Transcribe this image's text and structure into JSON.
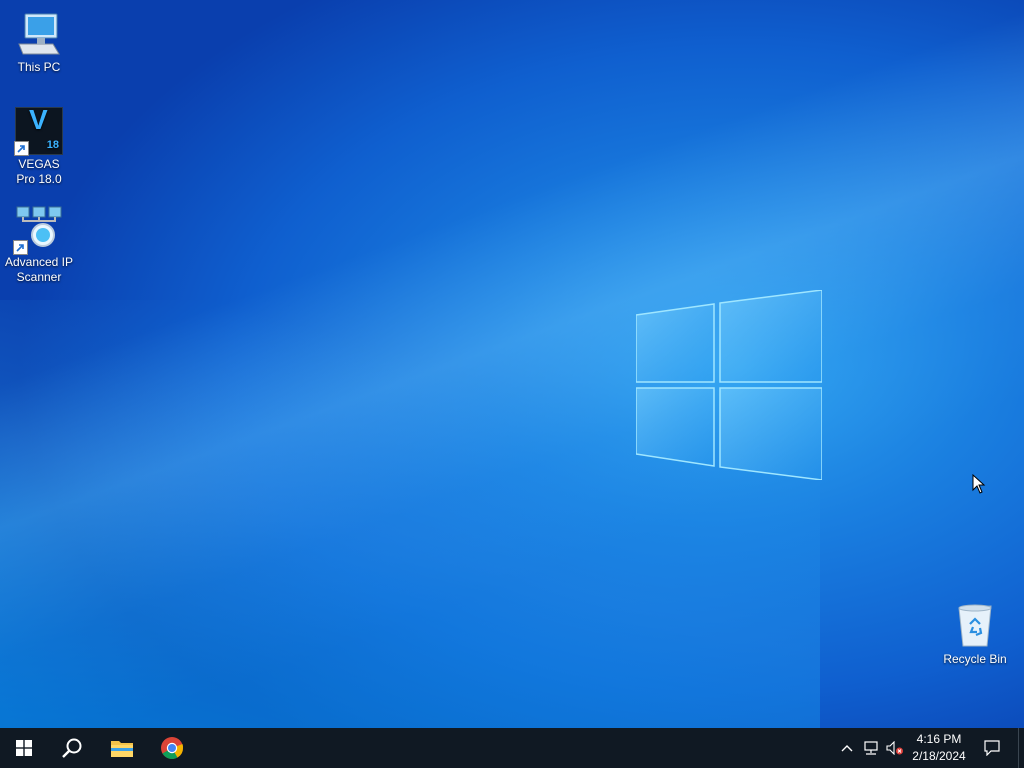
{
  "desktop": {
    "icons": [
      {
        "label": "This PC",
        "icon": "computer-icon"
      },
      {
        "label": "VEGAS Pro 18.0",
        "icon": "vegas-pro-icon",
        "badge_letter": "V",
        "badge_number": "18"
      },
      {
        "label": "Advanced IP Scanner",
        "icon": "network-scanner-icon"
      },
      {
        "label": "Recycle Bin",
        "icon": "recycle-bin-icon"
      }
    ]
  },
  "taskbar": {
    "apps": [
      "start-button",
      "search-button",
      "file-explorer",
      "google-chrome"
    ],
    "tray": {
      "time": "4:16 PM",
      "date": "2/18/2024"
    }
  },
  "colors": {
    "taskbar_bg": "#101923",
    "wallpaper_accent": "#1a7fe0"
  }
}
